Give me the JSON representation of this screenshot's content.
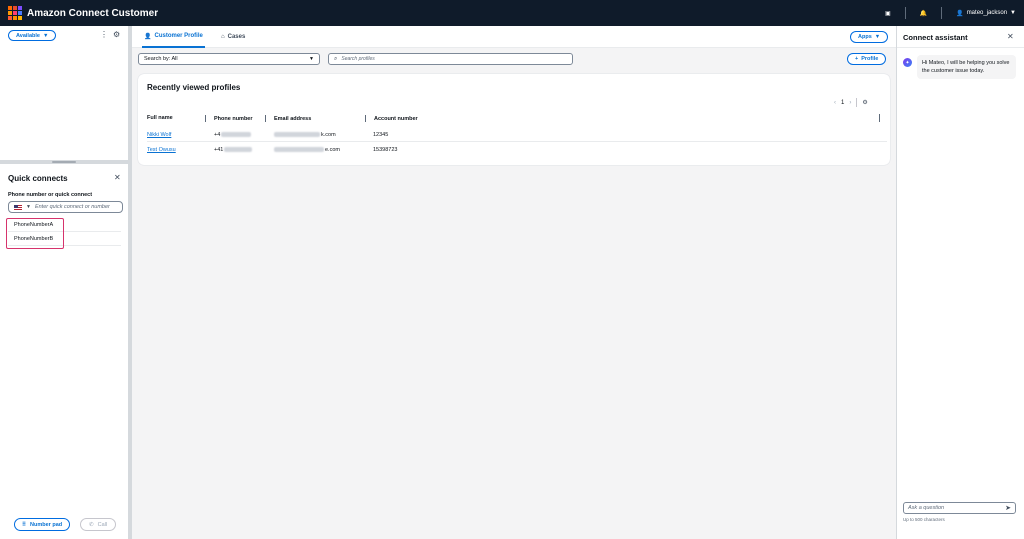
{
  "topbar": {
    "title": "Amazon Connect Customer",
    "username": "mateo_jackson",
    "logo_colors": [
      "#ff6a00",
      "#e64a2e",
      "#7d4dff",
      "#ff9900",
      "#ff3d71",
      "#4b7bff",
      "#ff5a36",
      "#ff8c00",
      "#ffb400"
    ]
  },
  "left": {
    "status_label": "Available",
    "quick_connects": {
      "title": "Quick connects",
      "field_label": "Phone number or quick connect",
      "placeholder": "Enter quick connect or number",
      "items": [
        "PhoneNumberA",
        "PhoneNumberB"
      ]
    },
    "number_pad_label": "Number pad",
    "call_label": "Call"
  },
  "main": {
    "tabs": [
      {
        "label": "Customer Profile",
        "active": true
      },
      {
        "label": "Cases",
        "active": false
      }
    ],
    "apps_label": "Apps",
    "search_by": "Search by: All",
    "search_placeholder": "Search profiles",
    "profile_button_label": "Profile",
    "recent": {
      "title": "Recently viewed profiles",
      "page": "1",
      "columns": [
        "Full name",
        "Phone number",
        "Email address",
        "Account number"
      ],
      "rows": [
        {
          "name": "Nikki Wolf",
          "phone": "+4",
          "email": "k.com",
          "account": "12345"
        },
        {
          "name": "Test Owusu",
          "phone": "+41",
          "email": "e.com",
          "account": "15398723"
        }
      ]
    }
  },
  "assistant": {
    "title": "Connect assistant",
    "message": "Hi Mateo, I will be helping you solve the customer issue today.",
    "ask_placeholder": "Ask a question",
    "char_limit": "Up to 500 characters"
  },
  "colors": {
    "accent": "#0972d3",
    "topbar": "#0f1b2a",
    "highlight": "#d6336c"
  }
}
